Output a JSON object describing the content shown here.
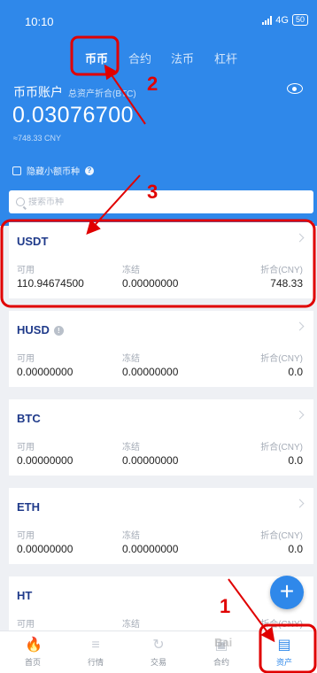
{
  "status_bar": {
    "time": "10:10",
    "network": "4G",
    "battery": "50"
  },
  "tabs": [
    {
      "label": "币币",
      "active": true
    },
    {
      "label": "合约",
      "active": false
    },
    {
      "label": "法币",
      "active": false
    },
    {
      "label": "杠杆",
      "active": false
    }
  ],
  "account": {
    "title": "币币账户",
    "subtitle": "总资产折合(BTC)",
    "balance_btc": "0.03076700",
    "balance_cny": "≈748.33 CNY",
    "hide_small_label": "隐藏小额币种"
  },
  "search": {
    "placeholder": "搜索币种"
  },
  "column_labels": {
    "available": "可用",
    "frozen": "冻结",
    "cny": "折合(CNY)"
  },
  "assets": [
    {
      "name": "USDT",
      "available": "110.94674500",
      "frozen": "0.00000000",
      "cny": "748.33"
    },
    {
      "name": "HUSD",
      "available": "0.00000000",
      "frozen": "0.00000000",
      "cny": "0.0"
    },
    {
      "name": "BTC",
      "available": "0.00000000",
      "frozen": "0.00000000",
      "cny": "0.0"
    },
    {
      "name": "ETH",
      "available": "0.00000000",
      "frozen": "0.00000000",
      "cny": "0.0"
    },
    {
      "name": "HT",
      "available": "",
      "frozen": "",
      "cny": ""
    }
  ],
  "bottom_nav": [
    {
      "label": "首页",
      "icon": "home-icon"
    },
    {
      "label": "行情",
      "icon": "market-icon"
    },
    {
      "label": "交易",
      "icon": "trade-icon"
    },
    {
      "label": "合约",
      "icon": "contract-icon"
    },
    {
      "label": "资产",
      "icon": "assets-icon",
      "active": true
    }
  ],
  "annotations": [
    {
      "number": "1"
    },
    {
      "number": "2"
    },
    {
      "number": "3"
    }
  ],
  "watermark": "Bai",
  "colors": {
    "primary": "#2f88ea",
    "annotation": "#e00000",
    "coin_name": "#1f3a8a"
  }
}
